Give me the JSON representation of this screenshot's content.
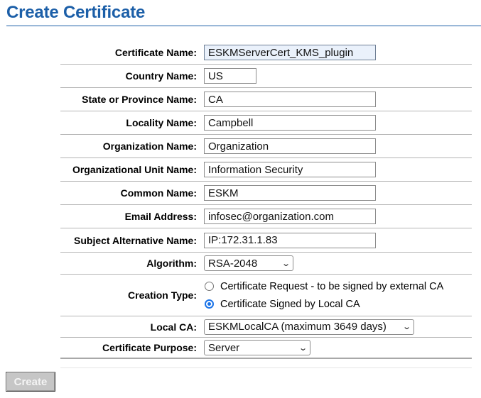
{
  "page": {
    "title": "Create Certificate"
  },
  "fields": {
    "certificate_name": {
      "label": "Certificate Name:",
      "value": "ESKMServerCert_KMS_plugin"
    },
    "country_name": {
      "label": "Country Name:",
      "value": "US"
    },
    "state_name": {
      "label": "State or Province Name:",
      "value": "CA"
    },
    "locality_name": {
      "label": "Locality Name:",
      "value": "Campbell"
    },
    "organization_name": {
      "label": "Organization Name:",
      "value": "Organization"
    },
    "org_unit_name": {
      "label": "Organizational Unit Name:",
      "value": "Information Security"
    },
    "common_name": {
      "label": "Common Name:",
      "value": "ESKM"
    },
    "email_address": {
      "label": "Email Address:",
      "value": "infosec@organization.com"
    },
    "subject_alt_name": {
      "label": "Subject Alternative Name:",
      "value": "IP:172.31.1.83"
    },
    "algorithm": {
      "label": "Algorithm:",
      "selected": "RSA-2048"
    },
    "creation_type": {
      "label": "Creation Type:",
      "options": [
        {
          "label": "Certificate Request - to be signed by external CA",
          "checked": false
        },
        {
          "label": "Certificate Signed by Local CA",
          "checked": true
        }
      ]
    },
    "local_ca": {
      "label": "Local CA:",
      "selected": "ESKMLocalCA (maximum 3649 days)"
    },
    "certificate_purpose": {
      "label": "Certificate Purpose:",
      "selected": "Server"
    }
  },
  "actions": {
    "create_label": "Create"
  },
  "colors": {
    "title": "#1c5fa8",
    "radio_accent": "#1a73e8",
    "button_disabled": "#c6c6c6"
  }
}
